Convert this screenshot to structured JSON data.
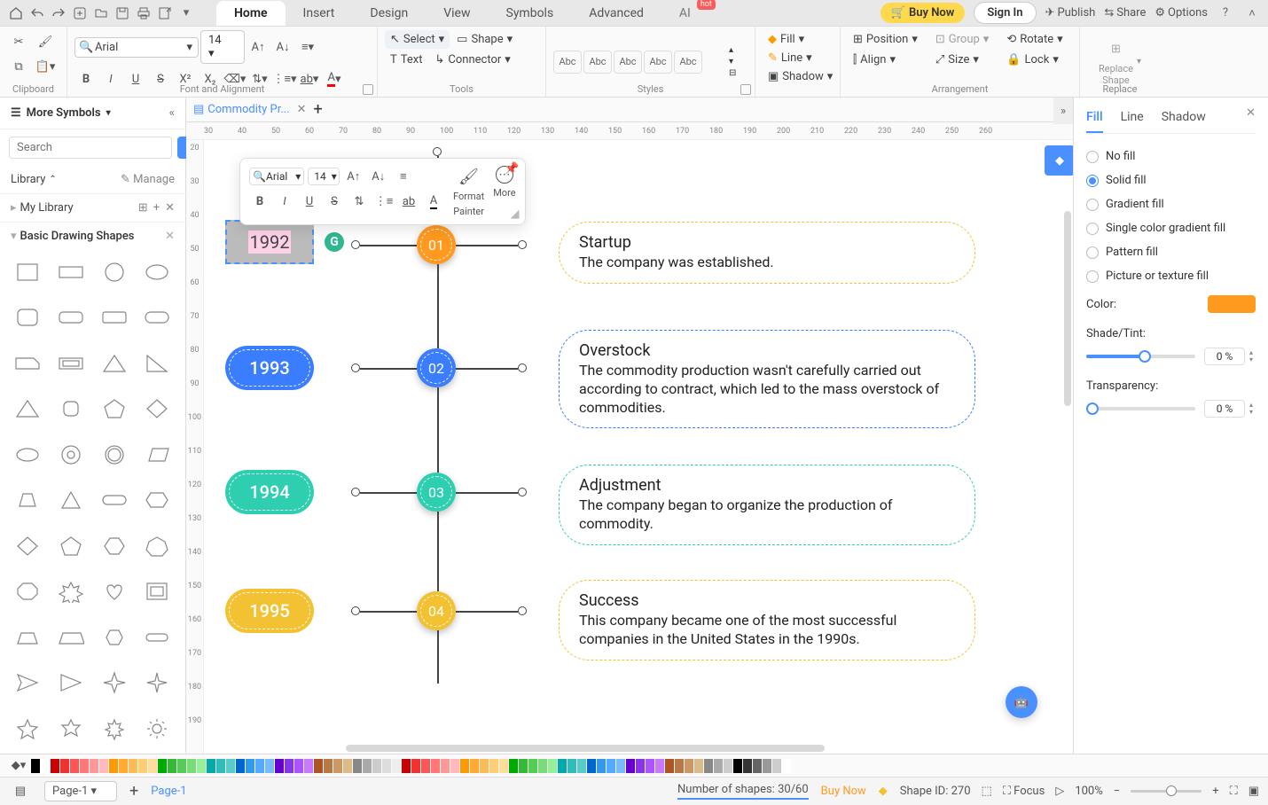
{
  "topbar": {
    "tabs": [
      "Home",
      "Insert",
      "Design",
      "View",
      "Symbols",
      "Advanced",
      "AI"
    ],
    "active_tab": "Home",
    "hot": "hot",
    "buy": "Buy Now",
    "signin": "Sign In",
    "publish": "Publish",
    "share": "Share",
    "options": "Options"
  },
  "ribbon": {
    "font": "Arial",
    "size": "14",
    "groups": {
      "clipboard": "Clipboard",
      "font": "Font and Alignment",
      "tools": "Tools",
      "styles": "Styles",
      "arrangement": "Arrangement",
      "replace": "Replace"
    },
    "select": "Select",
    "shape": "Shape",
    "text": "Text",
    "connector": "Connector",
    "fill": "Fill",
    "line": "Line",
    "shadow": "Shadow",
    "position": "Position",
    "group": "Group",
    "rotate": "Rotate",
    "align": "Align",
    "sizer": "Size",
    "lock": "Lock",
    "replace_shape": "Replace\nShape",
    "abc": "Abc"
  },
  "left": {
    "title": "More Symbols",
    "search_ph": "Search",
    "search_btn": "Search",
    "library": "Library",
    "manage": "Manage",
    "mylib": "My Library",
    "cat": "Basic Drawing Shapes"
  },
  "doc": {
    "tab": "Commodity Pr..."
  },
  "ruler_h": [
    "30",
    "40",
    "50",
    "60",
    "70",
    "80",
    "90",
    "100",
    "110",
    "120",
    "130",
    "140",
    "150",
    "160",
    "170",
    "180",
    "190",
    "200",
    "210",
    "220",
    "230",
    "240",
    "250",
    "260"
  ],
  "ruler_v": [
    "20",
    "30",
    "40",
    "50",
    "60",
    "70",
    "80",
    "90",
    "100",
    "110",
    "120",
    "130",
    "140",
    "150",
    "160",
    "170",
    "180",
    "190"
  ],
  "timeline": {
    "sel_year": "1992",
    "items": [
      {
        "year": "1993",
        "num": "02",
        "color": "#3a7dff",
        "title": "Overstock",
        "desc": "The commodity production wasn't carefully carried out according to contract, which led to the mass overstock of commodities."
      },
      {
        "year": "1994",
        "num": "03",
        "color": "#2ecfb0",
        "title": "Adjustment",
        "desc": "The company began to organize the production of commodity."
      },
      {
        "year": "1995",
        "num": "04",
        "color": "#f2c233",
        "title": "Success",
        "desc": "This company became one of the most successful companies in the United States in the 1990s."
      }
    ],
    "first": {
      "num": "01",
      "color": "#ff9a1f",
      "title": "Startup",
      "desc": "The company was established."
    }
  },
  "mini": {
    "font": "Arial",
    "size": "14",
    "fp1": "Format",
    "fp2": "Painter",
    "more": "More"
  },
  "props": {
    "tabs": [
      "Fill",
      "Line",
      "Shadow"
    ],
    "opts": [
      "No fill",
      "Solid fill",
      "Gradient fill",
      "Single color gradient fill",
      "Pattern fill",
      "Picture or texture fill"
    ],
    "selected": "Solid fill",
    "color_lbl": "Color:",
    "shade_lbl": "Shade/Tint:",
    "trans_lbl": "Transparency:",
    "shade_val": "0 %",
    "trans_val": "0 %"
  },
  "status": {
    "page": "Page-1",
    "page_link": "Page-1",
    "shapes_lbl": "Number of shapes:",
    "shapes_val": "30/60",
    "buy": "Buy Now",
    "shape_id_lbl": "Shape ID:",
    "shape_id_val": "270",
    "focus": "Focus",
    "zoom": "100%"
  },
  "colors": [
    "#000",
    "#fff",
    "#c00",
    "#e33",
    "#f55",
    "#f77",
    "#f99",
    "#fbb",
    "#f90",
    "#fa3",
    "#fb5",
    "#fc7",
    "#fd9",
    "#0a0",
    "#3b3",
    "#5c5",
    "#7d7",
    "#9e9",
    "#0aa",
    "#3bb",
    "#5cc",
    "#06c",
    "#39e",
    "#5af",
    "#7bf",
    "#60c",
    "#83e",
    "#a5f",
    "#c7f",
    "#a52",
    "#b74",
    "#c96",
    "#db8",
    "#888",
    "#aaa",
    "#ccc",
    "#ddd",
    "#eee",
    "#c00",
    "#e33",
    "#f55",
    "#f77",
    "#f99",
    "#fbb",
    "#f90",
    "#fa3",
    "#fb5",
    "#fc7",
    "#fd9",
    "#0a0",
    "#3b3",
    "#5c5",
    "#7d7",
    "#9e9",
    "#0aa",
    "#3bb",
    "#5cc",
    "#06c",
    "#39e",
    "#5af",
    "#7bf",
    "#60c",
    "#83e",
    "#a5f",
    "#c7f",
    "#a52",
    "#b74",
    "#c96",
    "#db8",
    "#888",
    "#aaa",
    "#ccc",
    "#000",
    "#333",
    "#666",
    "#999",
    "#ccc",
    "#fff"
  ]
}
